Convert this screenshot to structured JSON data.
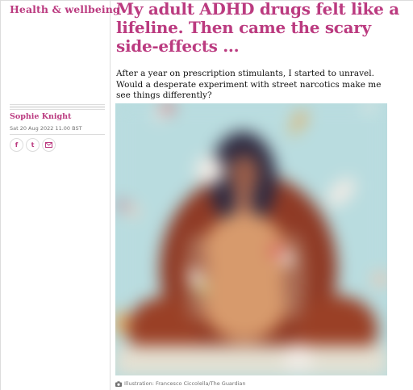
{
  "section": {
    "label": "Health & wellbeing"
  },
  "article": {
    "headline": "My adult ADHD drugs felt like a lifeline. Then came the scary side-effects ...",
    "standfirst": "After a year on prescription stimulants, I started to unravel. Would a desperate experiment with street narcotics make me see things differently?"
  },
  "byline": {
    "author": "Sophie Knight",
    "date": "Sat 20 Aug 2022 11.00 BST"
  },
  "share": {
    "facebook_glyph": "f",
    "twitter_glyph": "t",
    "email_icon": "envelope-icon"
  },
  "image": {
    "caption": "Illustration: Francesco Ciccolella/The Guardian",
    "background_color": "#b9dcdf"
  },
  "colors": {
    "accent": "#bb3b80",
    "rule": "#dcdcdc",
    "meta": "#707070"
  }
}
